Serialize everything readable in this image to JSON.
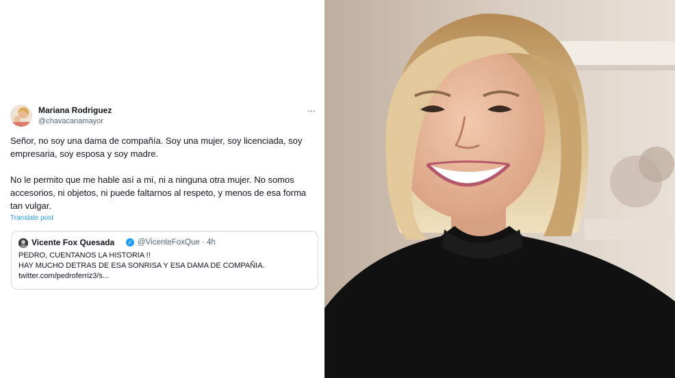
{
  "tweet": {
    "author_name": "Mariana Rodriguez",
    "author_handle": "@chavacanamayor",
    "more_label": "···",
    "paragraph1": "Señor, no soy una dama de compañía. Soy una mujer, soy licenciada, soy empresaria, soy esposa y soy madre.",
    "paragraph2": "No le permito que me hable así a mí, ni a ninguna otra mujer. No somos accesorios, ni objetos, ni puede faltarnos al respeto, y menos de esa forma tan vulgar.",
    "translate_label": "Translate post"
  },
  "quote": {
    "author_name": "Vicente Fox Quesada",
    "verified_icon": "verified-badge-icon",
    "author_handle": "@VicenteFoxQue · 4h",
    "line1": "PEDRO, CUENTANOS LA HISTORIA !!",
    "line2": "HAY MUCHO DETRAS DE ESA SONRISA Y ESA DAMA DE COMPAÑIA.",
    "line3": "twitter.com/pedroferriz3/s..."
  },
  "colors": {
    "link": "#1d9bf0",
    "secondary_text": "#536471",
    "primary_text": "#0f1419",
    "border": "#cfd9de"
  }
}
